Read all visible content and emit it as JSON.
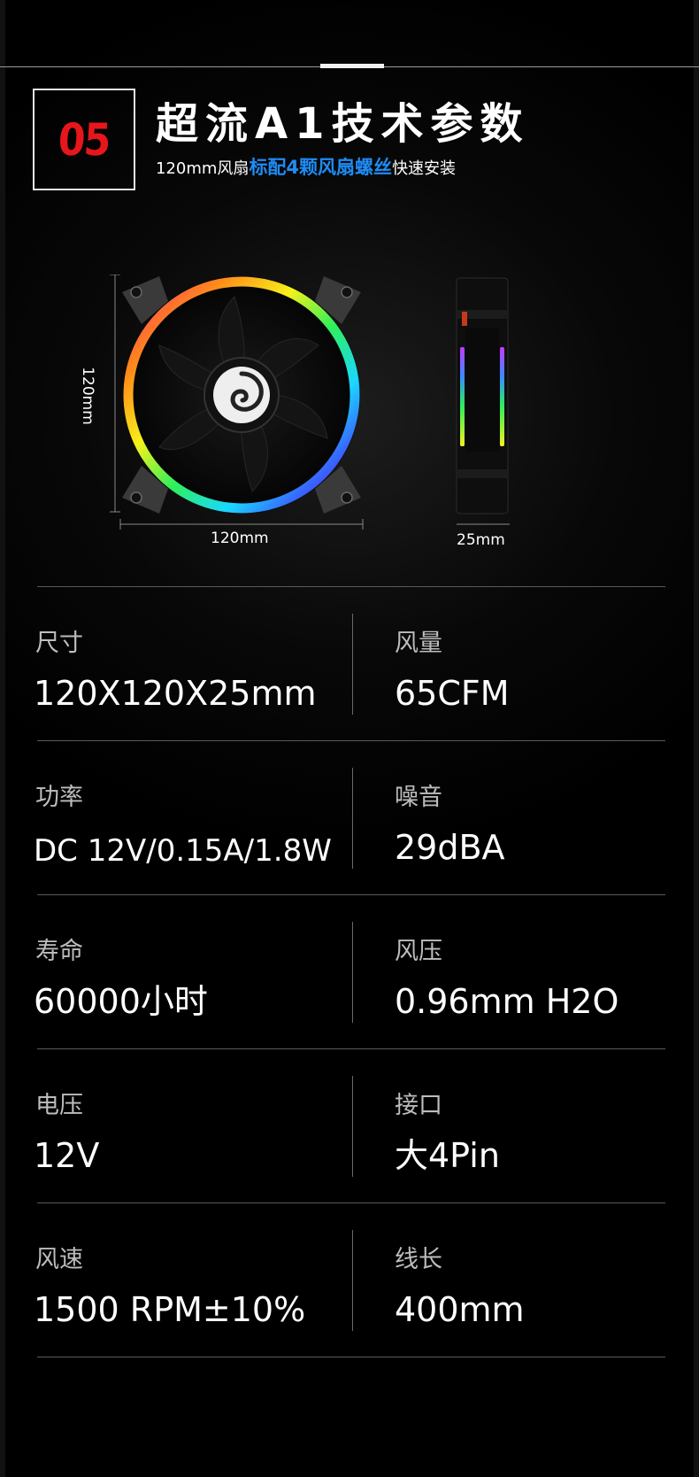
{
  "section": {
    "number": "05",
    "title": "超流A1技术参数",
    "subtitle_pre": "120mm风扇",
    "subtitle_highlight": "标配4颗风扇螺丝",
    "subtitle_post": "快速安装"
  },
  "dimensions": {
    "height": "120mm",
    "width": "120mm",
    "depth": "25mm"
  },
  "specs": [
    {
      "label": "尺寸",
      "value": "120X120X25mm"
    },
    {
      "label": "风量",
      "value": "65CFM"
    },
    {
      "label": "功率",
      "value": "DC 12V/0.15A/1.8W"
    },
    {
      "label": "噪音",
      "value": "29dBA"
    },
    {
      "label": "寿命",
      "value": "60000小时"
    },
    {
      "label": "风压",
      "value": "0.96mm H2O"
    },
    {
      "label": "电压",
      "value": "12V"
    },
    {
      "label": "接口",
      "value": "大4Pin"
    },
    {
      "label": "风速",
      "value": "1500 RPM±10%"
    },
    {
      "label": "线长",
      "value": "400mm"
    }
  ],
  "colors": {
    "number_red": "#e8161b",
    "highlight_blue": "#1e8cf5"
  }
}
